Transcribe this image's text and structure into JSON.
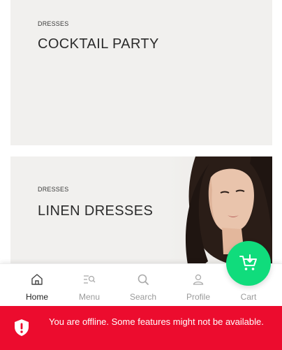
{
  "banners": [
    {
      "category": "DRESSES",
      "title": "COCKTAIL PARTY"
    },
    {
      "category": "DRESSES",
      "title": "LINEN DRESSES",
      "image": "woman-portrait-photo"
    }
  ],
  "nav": {
    "items": [
      {
        "label": "Home",
        "icon": "home-icon",
        "active": true
      },
      {
        "label": "Menu",
        "icon": "menu-search-icon",
        "active": false
      },
      {
        "label": "Search",
        "icon": "search-icon",
        "active": false
      },
      {
        "label": "Profile",
        "icon": "user-icon",
        "active": false
      },
      {
        "label": "Cart",
        "icon": "cart-icon",
        "active": false
      }
    ]
  },
  "cart_fab": {
    "icon": "cart-add-icon",
    "color": "#10dc7c"
  },
  "offline": {
    "message": "You are offline. Some features might not be available.",
    "icon": "shield-alert-icon",
    "color": "#ec0c2e"
  }
}
